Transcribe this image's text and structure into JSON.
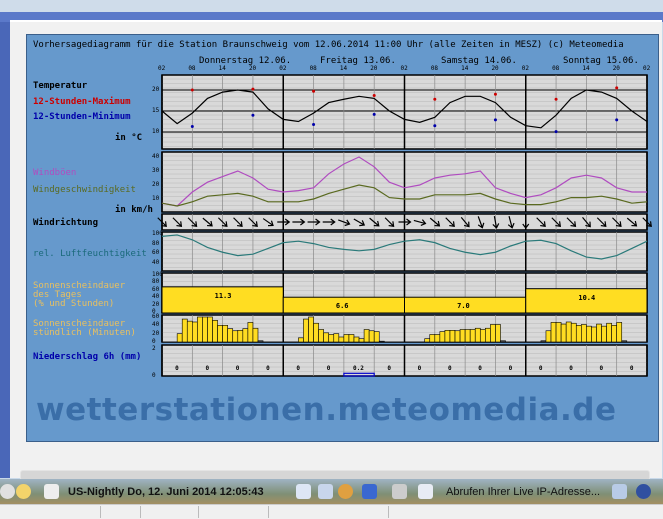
{
  "chart_title": "Vorhersagediagramm für die Station Braunschweig vom 12.06.2014 11:00 Uhr (alle Zeiten in MESZ)    (c) Meteomedia",
  "days": [
    "Donnerstag 12.06.",
    "Freitag 13.06.",
    "Samstag 14.06.",
    "Sonntag 15.06."
  ],
  "hour_ticks": [
    "02",
    "08",
    "14",
    "20",
    "02",
    "08",
    "14",
    "20",
    "02",
    "08",
    "14",
    "20",
    "02",
    "08",
    "14",
    "20",
    "02"
  ],
  "labels": {
    "temperature": "Temperatur",
    "max12": "12-Stunden-Maximum",
    "min12": "12-Stunden-Minimum",
    "temp_unit": "in °C",
    "gusts": "Windböen",
    "wind_speed": "Windgeschwindigkeit",
    "wind_unit": "in km/h",
    "wind_dir": "Windrichtung",
    "humidity": "rel. Luftfeuchtigkeit",
    "sun_daily": "Sonnenscheindauer\ndes Tages\n(% und Stunden)",
    "sun_hourly": "Sonnenscheindauer\nstündlich (Minuten)",
    "precip": "Niederschlag 6h (mm)"
  },
  "colors": {
    "panel_bg": "#6699cc",
    "plot_bg": "#d9d9d9",
    "max": "#cc0000",
    "min": "#0000aa",
    "gusts": "#b04cc0",
    "wind": "#5a6a20",
    "humidity": "#2a7a7a",
    "sun": "#ffdd22",
    "sun_label": "#e8c060",
    "precip_label": "#0000aa"
  },
  "chart_data": {
    "type": "line",
    "time_step_hours": 3,
    "start": "Do 12.06. 02:00",
    "temperature": {
      "axis_ticks": [
        20,
        15,
        10
      ],
      "ylim": [
        6,
        23.6
      ],
      "values": [
        15,
        12,
        14.5,
        18,
        19.5,
        20,
        19.5,
        15.5,
        13,
        12.5,
        14.5,
        17,
        17.8,
        18.5,
        18,
        15,
        13,
        12.3,
        13.5,
        17,
        18.5,
        18.5,
        17,
        13.5,
        11.5,
        11,
        14,
        18,
        20,
        19.5,
        18,
        15,
        12.5
      ],
      "max_12h": [
        {
          "t": "Do 08",
          "v": 20
        },
        {
          "t": "Do 20",
          "v": 20.2
        },
        {
          "t": "Fr 08",
          "v": 19.7
        },
        {
          "t": "Fr 20",
          "v": 18.7
        },
        {
          "t": "Sa 08",
          "v": 17.8
        },
        {
          "t": "Sa 20",
          "v": 19
        },
        {
          "t": "So 08",
          "v": 17.8
        },
        {
          "t": "So 20",
          "v": 20.5
        }
      ],
      "min_12h": [
        {
          "t": "Do 08",
          "v": 11.3
        },
        {
          "t": "Do 20",
          "v": 14
        },
        {
          "t": "Fr 08",
          "v": 11.8
        },
        {
          "t": "Fr 20",
          "v": 14.2
        },
        {
          "t": "Sa 08",
          "v": 11.5
        },
        {
          "t": "Sa 20",
          "v": 12.9
        },
        {
          "t": "So 08",
          "v": 10.1
        },
        {
          "t": "So 20",
          "v": 12.9
        }
      ]
    },
    "wind": {
      "axis_ticks": [
        40,
        30,
        20,
        10
      ],
      "ylim": [
        0.7,
        43.6
      ],
      "gusts": [
        7,
        5,
        15,
        22,
        26,
        30,
        25,
        17,
        15,
        16,
        18,
        28,
        35,
        40,
        33,
        22,
        18,
        20,
        25,
        27,
        28,
        30,
        18,
        14,
        11,
        13,
        18,
        25,
        27,
        25,
        18,
        15,
        15
      ],
      "speed": [
        7,
        5,
        8,
        12,
        13,
        14,
        12,
        8,
        8,
        8,
        10,
        14,
        17,
        20,
        18,
        11,
        10,
        10,
        13,
        13,
        13,
        14,
        10,
        7,
        6,
        6,
        8,
        11,
        11,
        12,
        10,
        7,
        8
      ]
    },
    "wind_direction_deg": [
      45,
      45,
      45,
      40,
      45,
      45,
      45,
      35,
      0,
      0,
      0,
      0,
      20,
      30,
      40,
      45,
      0,
      15,
      40,
      45,
      50,
      70,
      80,
      75,
      90,
      45,
      45,
      45,
      50,
      45,
      45,
      40,
      45
    ],
    "humidity": {
      "axis_ticks": [
        100,
        80,
        60,
        40
      ],
      "ylim": [
        23,
        100
      ],
      "values": [
        95,
        98,
        88,
        72,
        62,
        55,
        58,
        70,
        82,
        85,
        80,
        72,
        68,
        65,
        68,
        78,
        85,
        88,
        82,
        70,
        62,
        57,
        62,
        75,
        85,
        87,
        80,
        65,
        52,
        48,
        55,
        70,
        85
      ]
    },
    "sun_daily": {
      "axis_ticks": [
        100,
        80,
        60,
        40,
        20,
        0
      ],
      "percent": [
        68,
        40,
        40,
        63
      ],
      "hours": [
        "11.3",
        "6.6",
        "7.0",
        "10.4"
      ]
    },
    "sun_hourly": {
      "axis_ticks": [
        60,
        40,
        20,
        0
      ],
      "minutes": [
        0,
        0,
        0,
        20,
        55,
        50,
        48,
        60,
        60,
        60,
        52,
        40,
        40,
        32,
        27,
        28,
        32,
        47,
        33,
        3,
        0,
        0,
        0,
        0,
        0,
        0,
        0,
        10,
        55,
        60,
        45,
        30,
        22,
        18,
        20,
        12,
        18,
        18,
        12,
        8,
        30,
        27,
        25,
        2,
        0,
        0,
        0,
        0,
        0,
        0,
        0,
        0,
        8,
        18,
        18,
        25,
        28,
        28,
        27,
        30,
        30,
        30,
        33,
        30,
        33,
        42,
        42,
        3,
        0,
        0,
        0,
        0,
        0,
        0,
        0,
        3,
        27,
        47,
        47,
        43,
        48,
        45,
        40,
        42,
        38,
        36,
        43,
        38,
        45,
        40,
        47,
        3,
        0,
        0,
        0,
        0
      ]
    },
    "precip_6h": {
      "axis_ticks": [
        2,
        0
      ],
      "values": [
        "0",
        "0",
        "0",
        "0",
        "0",
        "0",
        "0.2",
        "0",
        "0",
        "0",
        "0",
        "0",
        "0",
        "0",
        "0",
        "0"
      ]
    }
  },
  "watermark": "wetterstationen.meteomedia.de",
  "taskbar": {
    "clock_text": "US-Nightly  Do, 12. Juni 2014   12:05:43",
    "status_text": "Abrufen Ihrer Live IP-Adresse..."
  }
}
